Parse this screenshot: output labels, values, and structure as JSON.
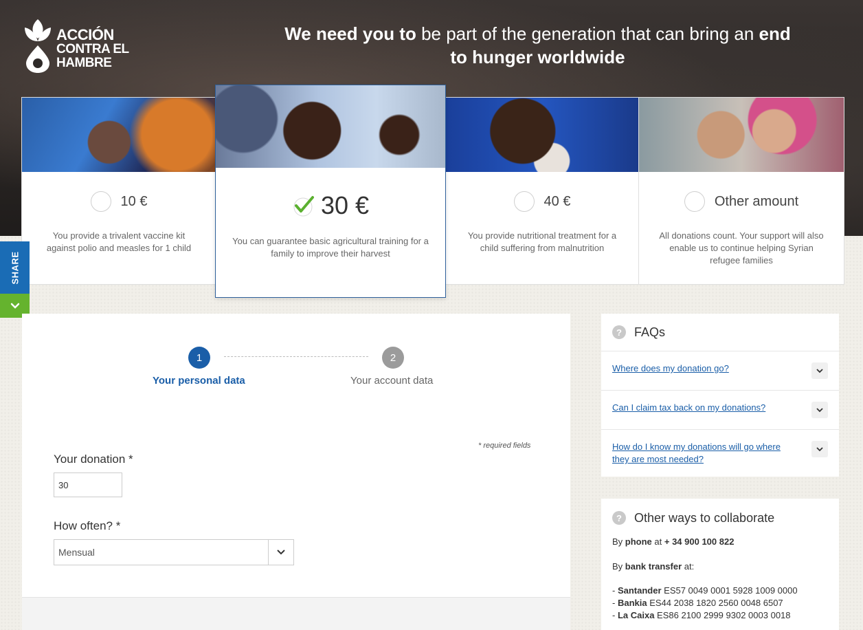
{
  "brand": {
    "logo_line1": "ACCIÓN",
    "logo_line2": "CONTRA EL",
    "logo_line3": "HAMBRE"
  },
  "headline": {
    "part1": "We need you to",
    "part2": " be part of the generation that can bring an ",
    "part3": "end to hunger worldwide"
  },
  "cards": [
    {
      "amount": "10 €",
      "desc": "You provide a trivalent vaccine kit against polio and measles for 1 child",
      "selected": false
    },
    {
      "amount": "30 €",
      "desc": "You can guarantee basic agricultural training for a family to improve their harvest",
      "selected": true
    },
    {
      "amount": "40 €",
      "desc": "You provide nutritional treatment for a child suffering from malnutrition",
      "selected": false
    },
    {
      "amount": "Other amount",
      "desc": "All donations count. Your support will also enable us to continue helping Syrian refugee families",
      "selected": false
    }
  ],
  "share": {
    "label": "SHARE"
  },
  "steps": [
    {
      "number": "1",
      "label": "Your personal data",
      "active": true
    },
    {
      "number": "2",
      "label": "Your account data",
      "active": false
    }
  ],
  "form": {
    "required_note": "* required fields",
    "donation_label": "Your donation *",
    "donation_value": "30",
    "frequency_label": "How often? *",
    "frequency_value": "Mensual"
  },
  "faqs": {
    "title": "FAQs",
    "items": [
      "Where does my donation go?",
      "Can I claim tax back on my donations?",
      "How do I know my donations will go where they are most needed?"
    ]
  },
  "other_ways": {
    "title": "Other ways to collaborate",
    "phone_prefix": "By ",
    "phone_bold": "phone",
    "phone_mid": " at ",
    "phone_number": "+ 34 900 100 822",
    "bank_prefix": "By ",
    "bank_bold": "bank transfer",
    "bank_suffix": " at:",
    "banks": [
      {
        "name": "Santander",
        "iban": " ES57 0049 0001 5928 1009 0000"
      },
      {
        "name": "Bankia",
        "iban": " ES44 2038 1820 2560 0048 6507"
      },
      {
        "name": "La Caixa",
        "iban": " ES86 2100 2999 9302 0003 0018"
      }
    ]
  },
  "colors": {
    "accent": "#1a5ea8",
    "share": "#1a6cb5",
    "share_toggle": "#65b32e",
    "check": "#5bb030",
    "step_inactive": "#9b9b9b"
  }
}
